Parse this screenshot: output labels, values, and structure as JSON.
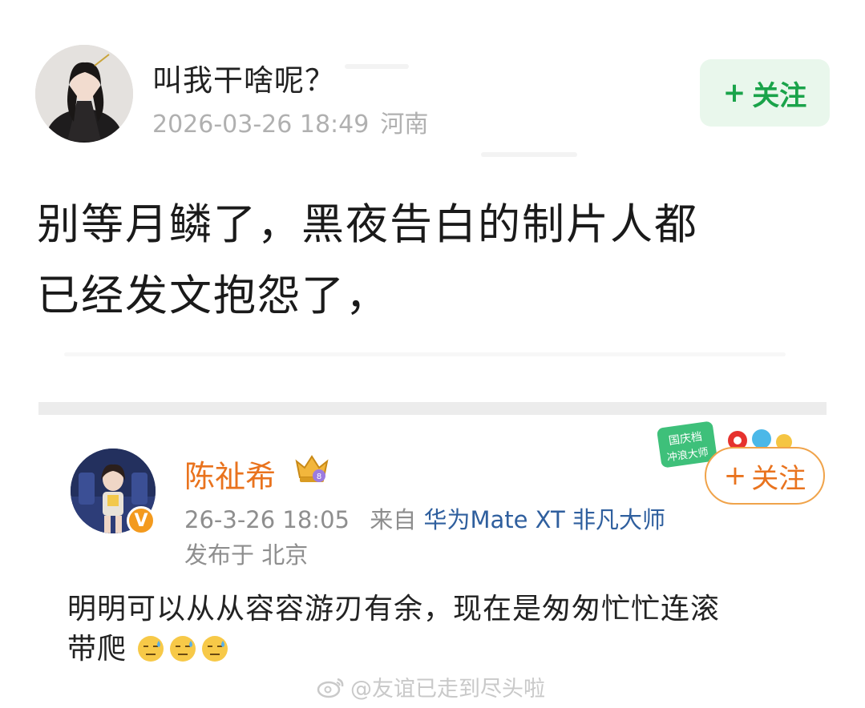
{
  "post": {
    "username": "叫我干啥呢？",
    "date": "2026-03-26 18:49",
    "location": "河南",
    "follow_label": "关注",
    "text_line1": "别等月鳞了，黑夜告白的制片人都",
    "text_line2": "已经发文抱怨了，"
  },
  "embedded": {
    "username": "陈祉希",
    "date": "26-3-26 18:05",
    "source_prefix": "来自",
    "device": "华为Mate XT 非凡大师",
    "published_in": "发布于 北京",
    "follow_label": "关注",
    "promo_line1": "国庆档",
    "promo_line2": "冲浪大师",
    "text_line1": "明明可以从从容容游刃有余，现在是匆匆忙忙连滚",
    "text_line2": "带爬"
  },
  "watermark": "@友谊已走到尽头啦",
  "colors": {
    "follow_green": "#1aa34a",
    "follow_bg": "#e9f7ec",
    "embed_orange": "#e9731e",
    "device_blue": "#2f5f9e"
  },
  "icons": {
    "crown_badge": "crown-icon",
    "vip_badge": "verified-badge-icon",
    "emoji": "sweat-emoji-icon",
    "weibo_logo": "weibo-logo-icon"
  }
}
